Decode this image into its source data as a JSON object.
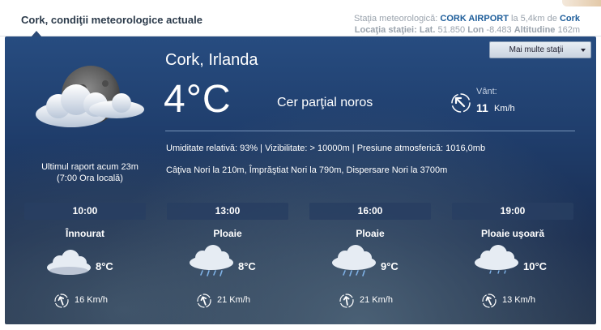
{
  "header": {
    "title": "Cork, condiţii meteorologice actuale",
    "station_prefix": "Staţia meteorologică:",
    "station_name": "CORK AIRPORT",
    "station_distance_prefix": "la 5,4km de",
    "station_city": "Cork",
    "location_label": "Locaţia staţiei:",
    "lat_label": "Lat.",
    "lat_value": "51.850",
    "lon_label": "Lon",
    "lon_value": "-8.483",
    "alt_label": "Altitudine",
    "alt_value": "162m"
  },
  "more_stations_label": "Mai multe staţii",
  "current": {
    "city": "Cork, Irlanda",
    "temperature": "4°C",
    "condition": "Cer parţial noros",
    "wind_label": "Vânt:",
    "wind_speed": "11",
    "wind_unit": "Km/h",
    "last_report_line1": "Ultimul raport acum 23m",
    "last_report_line2": "(7:00 Ora locală)",
    "details": "Umiditate relativă: 93% | Vizibilitate: > 10000m | Presiune atmosferică: 1016,0mb",
    "clouds": "Câţiva Nori la 210m, Împrăştiat Nori la 790m, Dispersare Nori la 3700m"
  },
  "forecast": [
    {
      "time": "10:00",
      "condition": "Înnourat",
      "temperature": "8°C",
      "wind": "16 Km/h",
      "icon": "cloudy-icon"
    },
    {
      "time": "13:00",
      "condition": "Ploaie",
      "temperature": "8°C",
      "wind": "21 Km/h",
      "icon": "rain-icon"
    },
    {
      "time": "16:00",
      "condition": "Ploaie",
      "temperature": "9°C",
      "wind": "21 Km/h",
      "icon": "rain-icon"
    },
    {
      "time": "19:00",
      "condition": "Ploaie uşoară",
      "temperature": "10°C",
      "wind": "13 Km/h",
      "icon": "light-rain-icon"
    }
  ]
}
